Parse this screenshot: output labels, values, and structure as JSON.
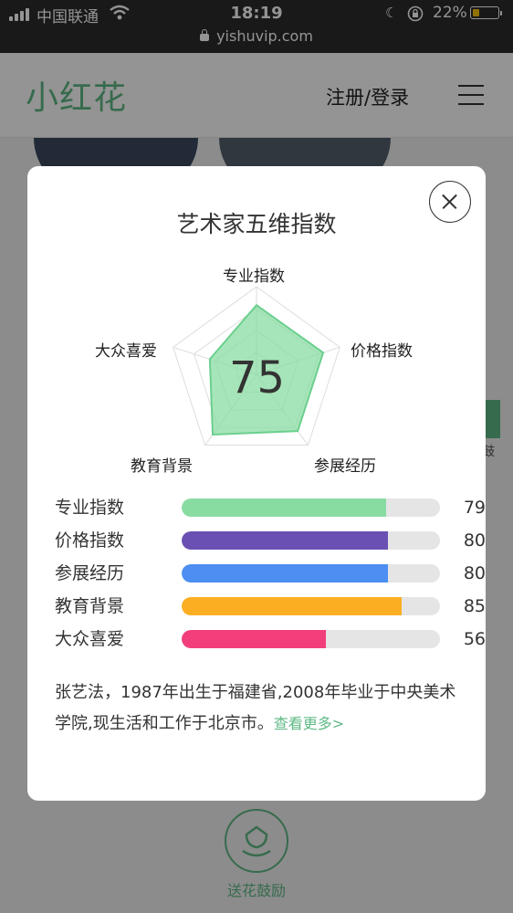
{
  "status_bar": {
    "carrier": "中国联通",
    "time": "18:19",
    "battery": "22%",
    "url": "yishuvip.com"
  },
  "header": {
    "logo": "小红花",
    "login_label": "注册/登录"
  },
  "background": {
    "side_text": "鼓",
    "flower_button_label": "送花鼓励"
  },
  "modal": {
    "title": "艺术家五维指数",
    "total_score": "75",
    "radar_labels": [
      "专业指数",
      "价格指数",
      "参展经历",
      "教育背景",
      "大众喜爱"
    ],
    "bars": [
      {
        "label": "专业指数",
        "value": 79,
        "color": "#88dca2"
      },
      {
        "label": "价格指数",
        "value": 80,
        "color": "#6a50b3"
      },
      {
        "label": "参展经历",
        "value": 80,
        "color": "#4c8ef1"
      },
      {
        "label": "教育背景",
        "value": 85,
        "color": "#fcae22"
      },
      {
        "label": "大众喜爱",
        "value": 56,
        "color": "#f23f7c"
      }
    ],
    "bio": "张艺法，1987年出生于福建省,2008年毕业于中央美术学院,现生活和工作于北京市。",
    "more_link": "查看更多>"
  },
  "colors": {
    "brand_green": "#5fb985",
    "radar_fill": "#88dca2"
  }
}
